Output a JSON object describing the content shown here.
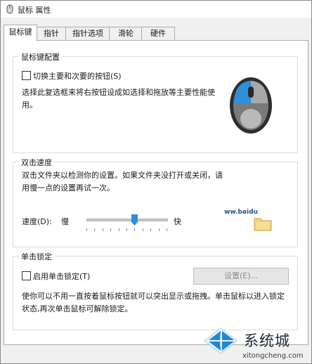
{
  "window": {
    "title": "鼠标 属性"
  },
  "tabs": [
    {
      "label": "鼠标键",
      "active": true
    },
    {
      "label": "指针"
    },
    {
      "label": "指针选项"
    },
    {
      "label": "滑轮"
    },
    {
      "label": "硬件"
    }
  ],
  "button_config": {
    "title": "鼠标键配置",
    "switch_label": "切换主要和次要的按钮(S)",
    "switch_checked": false,
    "description": "选择此复选框来将右按钮设成如选择和拖放等主要性能使用。"
  },
  "double_click": {
    "title": "双击速度",
    "description": "双击文件夹以检测你的设置。如果文件夹没打开或关闭，请用慢一点的设置再试一次。",
    "speed_label": "速度(D):",
    "slow_label": "慢",
    "fast_label": "快",
    "speed_fraction": 0.6,
    "folder_caption": "ww.baidu"
  },
  "click_lock": {
    "title": "单击锁定",
    "enable_label": "启用单击锁定(T)",
    "enable_checked": false,
    "settings_label": "设置(E)...",
    "description": "使你可以不用一直按着鼠标按钮就可以突出显示或拖拽。单击鼠标以进入锁定状态,再次单击鼠标可解除锁定。"
  },
  "watermark": {
    "brand": "系统城",
    "url": "xitongcheng.com"
  },
  "colors": {
    "accent": "#2f8fd8",
    "mouse_body": "#6a6a6a",
    "folder": "#f3d27a"
  }
}
